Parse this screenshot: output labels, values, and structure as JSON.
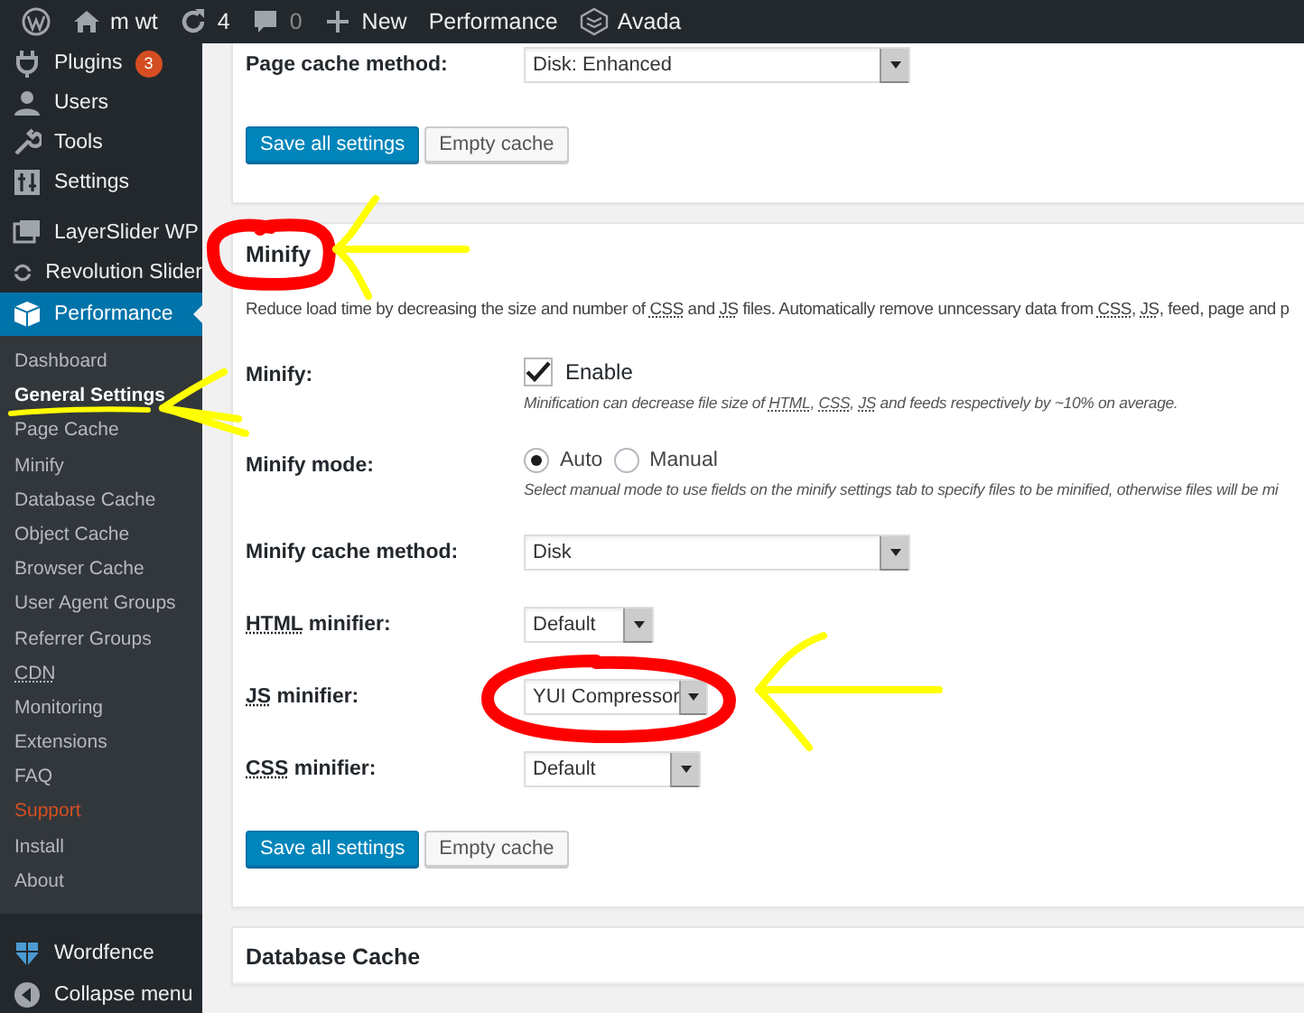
{
  "admin_bar": {
    "items": [
      {
        "kind": "logo"
      },
      {
        "kind": "site",
        "label": "m wt"
      },
      {
        "kind": "updates",
        "label": "4"
      },
      {
        "kind": "comments",
        "label": "0"
      },
      {
        "kind": "new",
        "label": "New"
      },
      {
        "kind": "text",
        "label": "Performance"
      },
      {
        "kind": "avada",
        "label": "Avada"
      }
    ]
  },
  "sidebar": {
    "groups": [
      [
        {
          "kind": "plugin",
          "label": "Plugins",
          "badge": "3",
          "selected": false
        },
        {
          "kind": "user",
          "label": "Users",
          "selected": false
        },
        {
          "kind": "wrench",
          "label": "Tools",
          "selected": false
        },
        {
          "kind": "sliders",
          "label": "Settings",
          "selected": false
        }
      ],
      [
        {
          "kind": "layers",
          "label": "LayerSlider WP",
          "selected": false
        },
        {
          "kind": "refresh",
          "label": "Revolution Slider",
          "selected": false
        },
        {
          "kind": "cube",
          "label": "Performance",
          "selected": true,
          "children": [
            {
              "label": "Dashboard",
              "selected": false,
              "attention": false
            },
            {
              "label": "General Settings",
              "selected": true,
              "attention": false
            },
            {
              "label": "Page Cache",
              "selected": false,
              "attention": false
            },
            {
              "label": "Minify",
              "selected": false,
              "attention": false
            },
            {
              "label": "Database Cache",
              "selected": false,
              "attention": false
            },
            {
              "label": "Object Cache",
              "selected": false,
              "attention": false
            },
            {
              "label": "Browser Cache",
              "selected": false,
              "attention": false
            },
            {
              "label": "User Agent Groups",
              "selected": false,
              "attention": false
            },
            {
              "label": "Referrer Groups",
              "selected": false,
              "attention": false
            },
            {
              "label": "CDN",
              "selected": false,
              "attention": false,
              "abbr": true
            },
            {
              "label": "Monitoring",
              "selected": false,
              "attention": false
            },
            {
              "label": "Extensions",
              "selected": false,
              "attention": false
            },
            {
              "label": "FAQ",
              "selected": false,
              "attention": false
            },
            {
              "label": "Support",
              "selected": false,
              "attention": true
            },
            {
              "label": "Install",
              "selected": false,
              "attention": false
            },
            {
              "label": "About",
              "selected": false,
              "attention": false
            }
          ]
        }
      ],
      [
        {
          "kind": "shield",
          "label": "Wordfence",
          "selected": false
        },
        {
          "kind": "collapse",
          "label": "Collapse menu",
          "selected": false
        }
      ]
    ]
  },
  "sections": [
    {
      "kind": "tail",
      "fields": [
        {
          "label": [
            {
              "text": "Page cache method:"
            }
          ],
          "control": {
            "kind": "select",
            "value": "Disk: Enhanced"
          }
        }
      ],
      "buttons": [
        {
          "kind": "primary",
          "label": "Save all settings"
        },
        {
          "kind": "secondary",
          "label": "Empty cache"
        }
      ]
    },
    {
      "kind": "full",
      "title": "Minify",
      "description": [
        {
          "text": "Reduce load time by decreasing the size and number of "
        },
        {
          "text": "CSS",
          "abbr": true
        },
        {
          "text": " and "
        },
        {
          "text": "JS",
          "abbr": true
        },
        {
          "text": " files. Automatically remove unncessary data from "
        },
        {
          "text": "CSS",
          "abbr": true
        },
        {
          "text": ", "
        },
        {
          "text": "JS",
          "abbr": true
        },
        {
          "text": ", feed, page and p"
        }
      ],
      "fields": [
        {
          "label": [
            {
              "text": "Minify:"
            }
          ],
          "control": {
            "kind": "checkbox",
            "label": "Enable",
            "checked": true
          },
          "help": [
            {
              "text": "Minification can decrease file size of "
            },
            {
              "text": "HTML",
              "abbr": true
            },
            {
              "text": ", "
            },
            {
              "text": "CSS",
              "abbr": true
            },
            {
              "text": ", "
            },
            {
              "text": "JS",
              "abbr": true
            },
            {
              "text": " and feeds respectively by ~10% on average."
            }
          ]
        },
        {
          "label": [
            {
              "text": "Minify mode:"
            }
          ],
          "control": {
            "kind": "radio",
            "options": [
              {
                "label": "Auto",
                "selected": true
              },
              {
                "label": "Manual",
                "selected": false
              }
            ]
          },
          "help": [
            {
              "text": "Select manual mode to use fields on the minify settings tab to specify files to be minified, otherwise files will be mi"
            }
          ]
        },
        {
          "label": [
            {
              "text": "Minify cache method:"
            }
          ],
          "control": {
            "kind": "select",
            "value": "Disk"
          }
        },
        {
          "label": [
            {
              "text": "HTML",
              "abbr": true
            },
            {
              "text": " minifier:"
            }
          ],
          "control": {
            "kind": "select",
            "value": "Default"
          }
        },
        {
          "label": [
            {
              "text": "JS",
              "abbr": true
            },
            {
              "text": " minifier:"
            }
          ],
          "control": {
            "kind": "select",
            "value": "YUI Compressor"
          }
        },
        {
          "label": [
            {
              "text": "CSS",
              "abbr": true
            },
            {
              "text": " minifier:"
            }
          ],
          "control": {
            "kind": "select",
            "value": "Default"
          }
        }
      ],
      "buttons": [
        {
          "kind": "primary",
          "label": "Save all settings"
        },
        {
          "kind": "secondary",
          "label": "Empty cache"
        }
      ]
    },
    {
      "kind": "head",
      "title": "Database Cache"
    }
  ],
  "annotations": [
    {
      "kind": "ring",
      "color": "#ff0000"
    },
    {
      "kind": "arrow",
      "color": "#ffff00"
    },
    {
      "kind": "underline",
      "color": "#ffff00"
    },
    {
      "kind": "arrow",
      "color": "#ffff00"
    },
    {
      "kind": "ring",
      "color": "#ff0000"
    },
    {
      "kind": "arrow",
      "color": "#ffff00"
    }
  ]
}
